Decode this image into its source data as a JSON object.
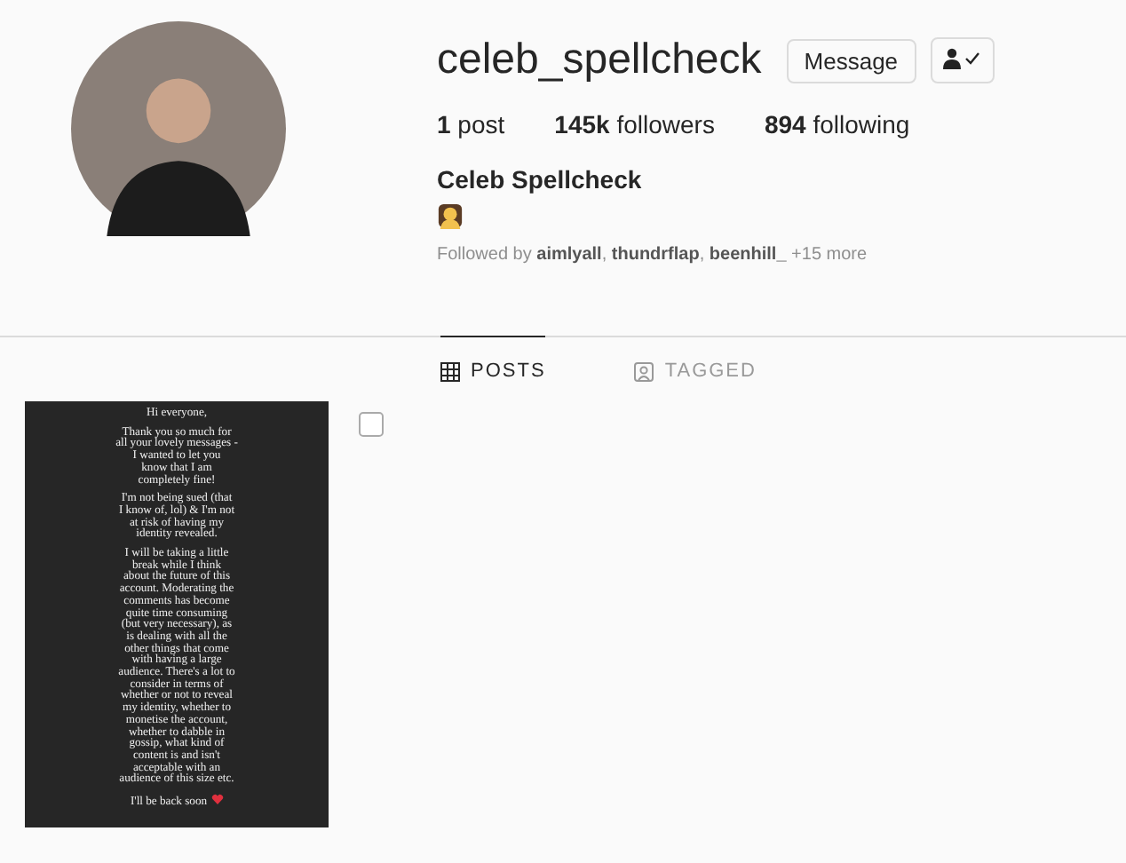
{
  "profile": {
    "username": "celeb_spellcheck",
    "buttons": [
      {
        "kind": "text",
        "label": "Message"
      },
      {
        "kind": "follow-icon"
      }
    ],
    "stats": [
      {
        "count": "1",
        "label": "post"
      },
      {
        "count": "145k",
        "label": "followers"
      },
      {
        "count": "894",
        "label": "following"
      }
    ],
    "name": "Celeb Spellcheck",
    "followed_by": "Followed by **aimlyall**, **thundrflap**, **beenhill_** +15 more"
  },
  "tabs": [
    {
      "label": "POSTS",
      "selected": true
    },
    {
      "label": "TAGGED",
      "selected": false
    }
  ],
  "posts": [
    {
      "paragraphs": [
        "Hi everyone,",
        "Thank you so much for\nall your lovely messages -\nI wanted to let you\nknow that I am\ncompletely fine!",
        "I'm not being sued (that\nI know of, lol) & I'm not\nat risk of having my\nidentity revealed.",
        "I will be taking a little\nbreak while I think\nabout the future of this\naccount. Moderating the\ncomments has become\nquite time consuming\n(but very necessary), as\nis dealing with all the\nother things that come\nwith having a large\naudience. There's a lot to\nconsider in terms of\nwhether or not to reveal\nmy identity, whether to\nmonetise the account,\nwhether to dabble in\ngossip, what kind of\ncontent is and isn't\nacceptable with an\naudience of this size etc.",
        "I'll be back soon"
      ]
    }
  ]
}
